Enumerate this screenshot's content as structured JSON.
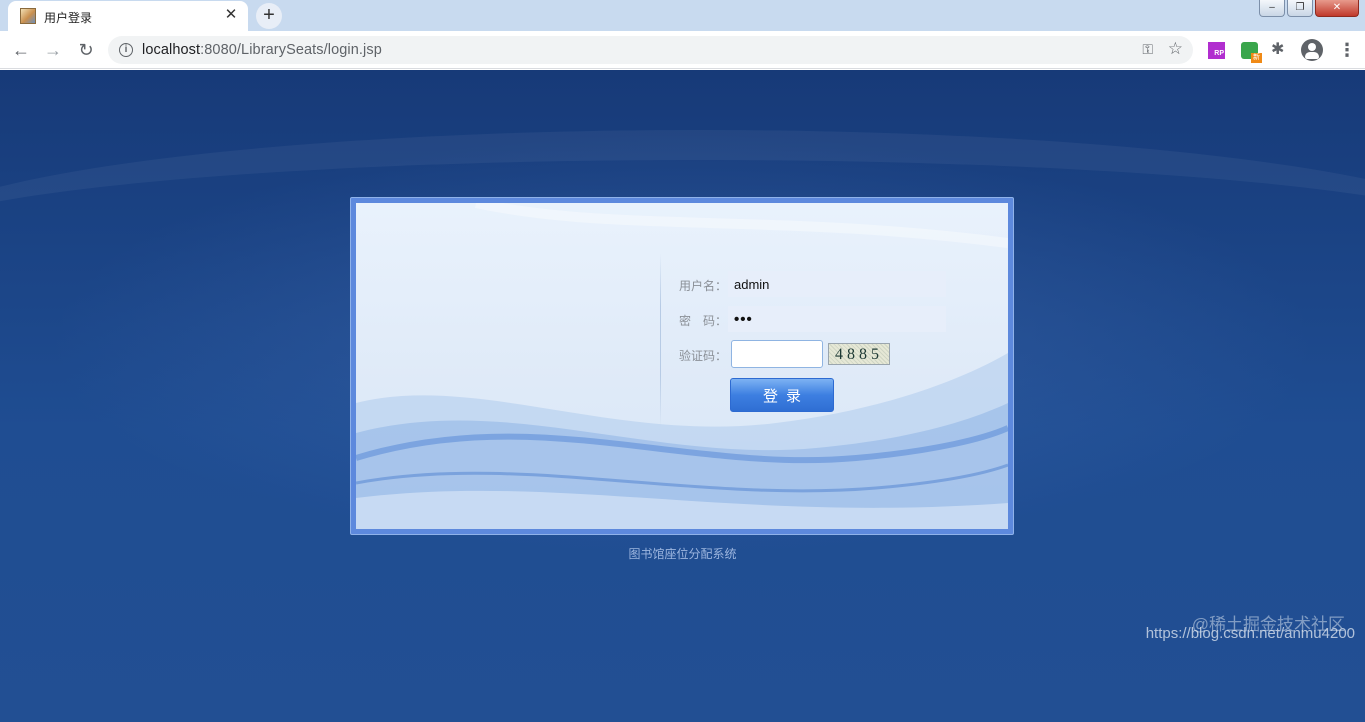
{
  "browser": {
    "tab_title": "用户登录",
    "tab_close": "✕",
    "new_tab": "+",
    "url_host": "localhost",
    "url_path": ":8080/LibrarySeats/login.jsp",
    "window_buttons": {
      "minimize": "–",
      "restore": "❐",
      "close": "✕"
    },
    "nav": {
      "back": "←",
      "forward": "→",
      "reload": "↻"
    },
    "icons": [
      "info-icon",
      "key-icon",
      "star-icon",
      "rp-extension-icon",
      "green-extension-icon",
      "puzzle-icon",
      "profile-icon",
      "menu-icon"
    ],
    "menu": "⋮"
  },
  "login": {
    "username_label": "用户名：",
    "username_value": "admin",
    "password_label": "密　码：",
    "password_value": "•••",
    "captcha_label": "验证码：",
    "captcha_input_value": "",
    "captcha_code": "4885",
    "submit_label": "登录"
  },
  "footer": {
    "system_name": "图书馆座位分配系统"
  },
  "watermark": {
    "line1": "@稀土掘金技术社区",
    "line2": "https://blog.csdn.net/anmu4200"
  },
  "colors": {
    "page_background": "#1d4689",
    "panel_border": "#5d89dd",
    "button": "#3d7fe1"
  }
}
